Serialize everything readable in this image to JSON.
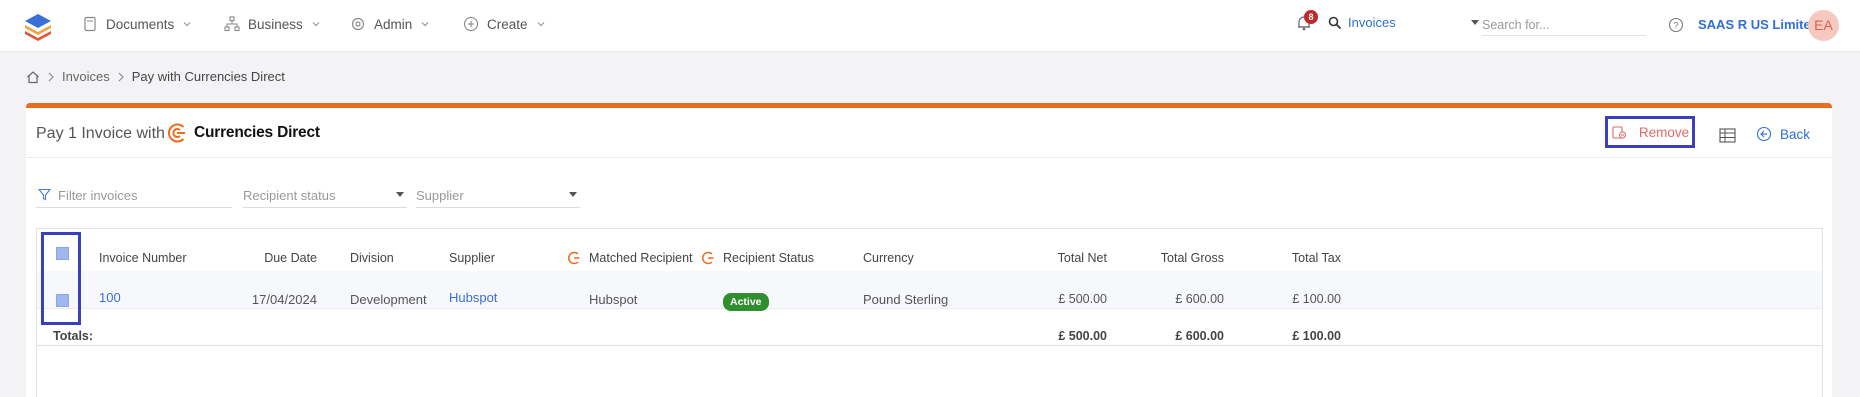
{
  "nav": {
    "items": [
      {
        "label": "Documents",
        "icon": "document-icon"
      },
      {
        "label": "Business",
        "icon": "org-chart-icon"
      },
      {
        "label": "Admin",
        "icon": "gear-icon"
      },
      {
        "label": "Create",
        "icon": "plus-circle-icon"
      }
    ],
    "notifications_count": "8",
    "search_scope": "Invoices",
    "search_placeholder": "Search for...",
    "org_name": "SAAS R US Limited",
    "avatar_initials": "EA"
  },
  "breadcrumb": {
    "items": [
      "Invoices",
      "Pay with Currencies Direct"
    ]
  },
  "page": {
    "title": "Pay 1 Invoice with",
    "provider_name": "Currencies Direct",
    "remove_label": "Remove",
    "back_label": "Back"
  },
  "filters": {
    "invoices_placeholder": "Filter invoices",
    "recipient_status_placeholder": "Recipient status",
    "supplier_placeholder": "Supplier"
  },
  "table": {
    "columns": [
      "Invoice Number",
      "Due Date",
      "Division",
      "Supplier",
      "Matched Recipient",
      "Recipient Status",
      "Currency",
      "Total Net",
      "Total Gross",
      "Total Tax"
    ],
    "rows": [
      {
        "invoice_number": "100",
        "due_date": "17/04/2024",
        "division": "Development",
        "supplier": "Hubspot",
        "matched_recipient": "Hubspot",
        "recipient_status": "Active",
        "currency": "Pound Sterling",
        "total_net": "£ 500.00",
        "total_gross": "£ 600.00",
        "total_tax": "£ 100.00"
      }
    ],
    "totals": {
      "label": "Totals:",
      "total_net": "£ 500.00",
      "total_gross": "£ 600.00",
      "total_tax": "£ 100.00"
    }
  },
  "colors": {
    "accent": "#ea6c1f",
    "link": "#2f6fd6",
    "active_badge": "#2f8f2f",
    "highlight": "#3a3fc0"
  }
}
